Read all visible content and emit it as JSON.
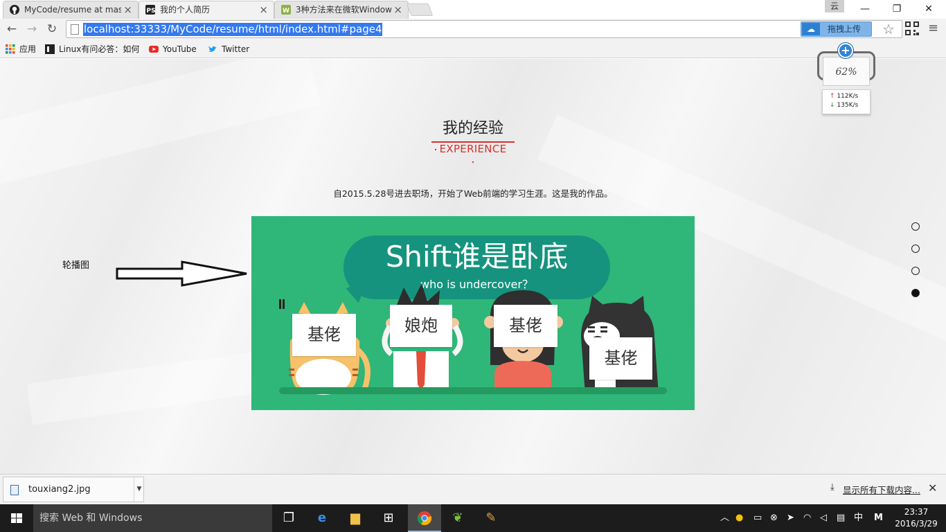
{
  "browser": {
    "tabs": [
      {
        "title": "MyCode/resume at mas",
        "icon": "github-icon",
        "active": false
      },
      {
        "title": "我的个人简历",
        "icon": "ps-icon",
        "active": true
      },
      {
        "title": "3种方法来在微软Window",
        "icon": "wikihow-icon",
        "active": false
      }
    ],
    "tab_close_glyph": "×",
    "user_badge": "云",
    "window_controls": {
      "minimize": "—",
      "maximize": "❐",
      "close": "✕"
    },
    "url": "localhost:33333/MyCode/resume/html/index.html#page4",
    "upload_button": "拖拽上传",
    "bookmarks": [
      {
        "label": "应用",
        "icon": "apps-grid-icon"
      },
      {
        "label": "Linux有问必答：如何",
        "icon": "bookmark-doc-icon"
      },
      {
        "label": "YouTube",
        "icon": "youtube-icon"
      },
      {
        "label": "Twitter",
        "icon": "twitter-icon"
      }
    ]
  },
  "page": {
    "section_title": "我的经验",
    "section_subtitle": "EXPERIENCE",
    "intro": "自2015.5.28号进去职场，开始了Web前端的学习生涯。这是我的作品。",
    "annotation_label": "轮播图",
    "slide": {
      "title": "Shift谁是卧底",
      "subtitle": "who is undercover？",
      "background_color": "#2fb679",
      "cards": [
        "基佬",
        "娘炮",
        "基佬",
        "基佬"
      ]
    },
    "pagination": {
      "total": 4,
      "active": 4
    }
  },
  "speed_widget": {
    "percent": "62%",
    "upload": "112K/s",
    "download": "135K/s"
  },
  "downloads": {
    "file": "touxiang2.jpg",
    "show_all": "显示所有下载内容..."
  },
  "taskbar": {
    "search_placeholder": "搜索 Web 和 Windows",
    "ime": "中",
    "ime_mode": "M",
    "time": "23:37",
    "date": "2016/3/29"
  },
  "colors": {
    "accent_red": "#d4322c",
    "selection_blue": "#3479ef",
    "slide_green": "#2fb679",
    "bubble_teal": "#15937e"
  }
}
